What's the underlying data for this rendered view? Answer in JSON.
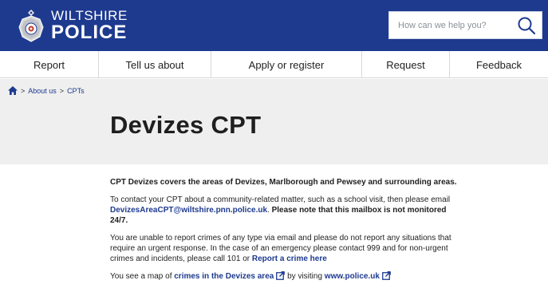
{
  "header": {
    "logo_top": "WILTSHIRE",
    "logo_bottom": "POLICE",
    "search_placeholder": "How can we help you?",
    "colors": {
      "header_bg": "#1e3a8f",
      "link": "#1e3a8f",
      "hero_bg": "#efefef"
    }
  },
  "nav": {
    "items": [
      {
        "label": "Report"
      },
      {
        "label": "Tell us about"
      },
      {
        "label": "Apply or register"
      },
      {
        "label": "Request"
      },
      {
        "label": "Feedback"
      }
    ]
  },
  "breadcrumb": {
    "home_icon": "home-icon",
    "separator": ">",
    "items": [
      "About us",
      "CPTs"
    ]
  },
  "page": {
    "title": "Devizes CPT"
  },
  "content": {
    "p1": "CPT Devizes covers the areas of Devizes, Marlborough and Pewsey and surrounding areas.",
    "p2_text": "To contact your CPT about a community-related matter, such as a school visit, then please email ",
    "p2_email": "DevizesAreaCPT@wiltshire.pnn.police.uk",
    "p2_sep": ". ",
    "p2_note": "Please note that this mailbox is not monitored 24/7.",
    "p3_text": "You are unable to report crimes of any type via email and please do not report any situations that require an urgent response. In the case of an emergency please contact 999 and for non-urgent crimes and incidents, please call 101 or ",
    "p3_link": "Report a crime here",
    "p4_text1": "You see a map of ",
    "p4_link1": "crimes in the Devizes area",
    "p4_text2": " by visiting ",
    "p4_link2": "www.police.uk"
  }
}
